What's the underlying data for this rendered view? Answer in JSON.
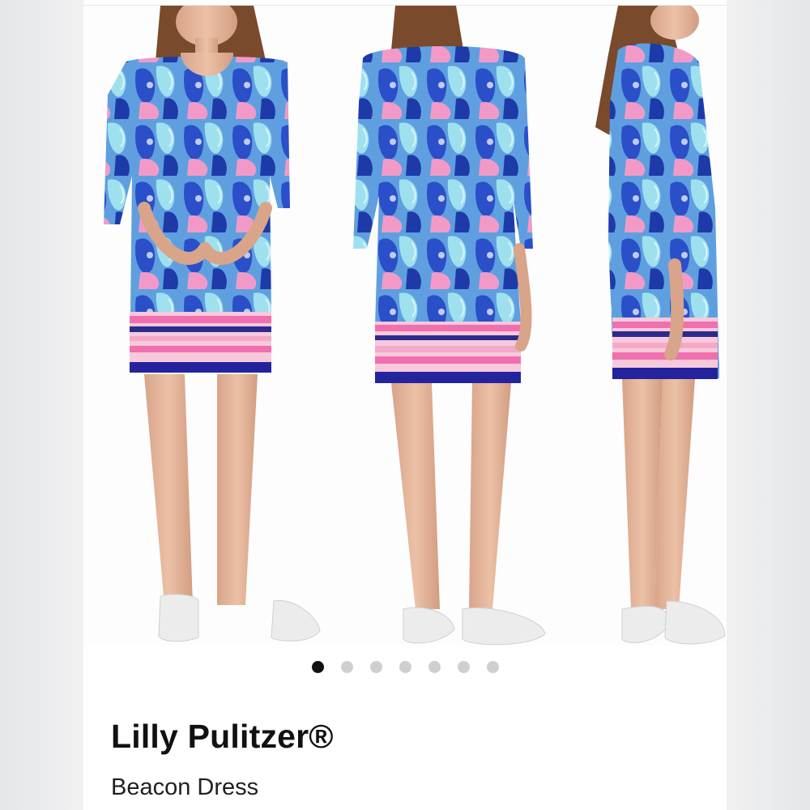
{
  "product": {
    "brand": "Lilly Pulitzer®",
    "name": "Beacon Dress"
  },
  "gallery": {
    "image_count": 7,
    "active_index": 0
  },
  "colors": {
    "print_blue": "#2f5fd0",
    "print_aqua": "#7fd0e6",
    "print_pink": "#f08cc0",
    "hem_navy": "#23239e",
    "dot_active": "#111111",
    "dot_inactive": "#cfcfcf"
  }
}
